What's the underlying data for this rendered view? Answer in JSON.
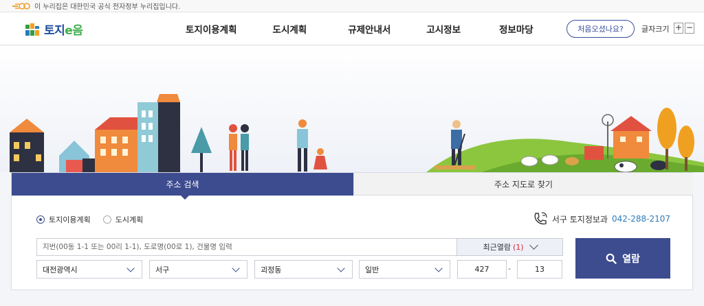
{
  "gov_banner": {
    "text": "이 누리집은 대한민국 공식 전자정부 누리집입니다."
  },
  "header": {
    "logo_text_main": "토지",
    "logo_text_accent": "e음",
    "nav": [
      "토지이용계획",
      "도시계획",
      "규제안내서",
      "고시정보",
      "정보마당"
    ],
    "first_visit": "처음오셨나요?",
    "font_size_label": "글자크기",
    "font_plus": "+",
    "font_minus": "−"
  },
  "search": {
    "tab_address": "주소 검색",
    "tab_map": "주소 지도로 찾기",
    "radio_land": "토지이용계획",
    "radio_city": "도시계획",
    "contact_label": "서구 토지정보과",
    "contact_phone": "042-288-2107",
    "input_placeholder": "지번(00동 1-1 또는 00리 1-1), 도로명(00로 1), 건물명 입력",
    "recent_label": "최근열람",
    "recent_count": "(1)",
    "sido": "대전광역시",
    "sigungu": "서구",
    "dong": "괴정동",
    "type": "일반",
    "bun": "427",
    "dash": "-",
    "ji": "13",
    "view_button": "열람"
  },
  "colors": {
    "primary": "#3d4b8f",
    "phone": "#2c7ab8",
    "accent_red": "#d9232e"
  },
  "icons": [
    "egov-logo-icon",
    "toji-logo-icon",
    "phone-icon",
    "search-icon",
    "chevron-down-icon"
  ]
}
